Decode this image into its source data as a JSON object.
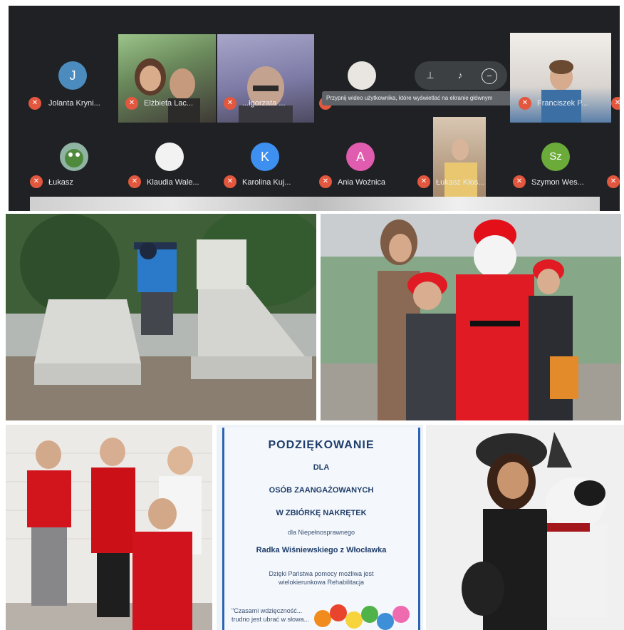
{
  "call": {
    "participants_row1": [
      {
        "name": "Jolanta Kryni...",
        "initial": "J",
        "color": "#4b8bbd"
      },
      {
        "name": "Elżbieta Lac...",
        "initial": "",
        "color": ""
      },
      {
        "name": "...łgorzata ...",
        "initial": "",
        "color": ""
      },
      {
        "name": "Franciszek P...",
        "initial": "",
        "color": ""
      }
    ],
    "participants_row2": [
      {
        "name": "Łukasz",
        "initial": "",
        "color": ""
      },
      {
        "name": "Klaudia Wale...",
        "initial": "",
        "color": ""
      },
      {
        "name": "Karolina Kuj...",
        "initial": "K",
        "color": "#3d8ff0"
      },
      {
        "name": "Ania Woźnica",
        "initial": "A",
        "color": "#e05cae"
      },
      {
        "name": "Łukasz Kłos...",
        "initial": "",
        "color": ""
      },
      {
        "name": "Szymon Wes...",
        "initial": "Sz",
        "color": "#6aab3a"
      }
    ],
    "tooltip": "Przypnij wideo użytkownika, które wyświetlać na ekranie głównym",
    "controls": [
      "pin-icon",
      "mute-icon",
      "remove-icon"
    ]
  },
  "thanks_card": {
    "title": "PODZIĘKOWANIE",
    "line1": "DLA",
    "line2": "OSÓB  ZAANGAŻOWANYCH",
    "line3": "W ZBIÓRKĘ NAKRĘTEK",
    "line4": "dla Niepełnosprawnego",
    "line5": "Radka Wiśniewskiego z Włocławka",
    "line6": "Dzięki Państwa pomocy możliwa jest",
    "line7": "wielokierunkowa Rehabilitacja",
    "line8": "\"Czasami wdzięczność...",
    "line9": "trudno jest ubrać w słowa..."
  },
  "colors": {
    "call_bg": "#1f2124",
    "mic_red": "#e2573e",
    "card_blue": "#2c64b4"
  }
}
